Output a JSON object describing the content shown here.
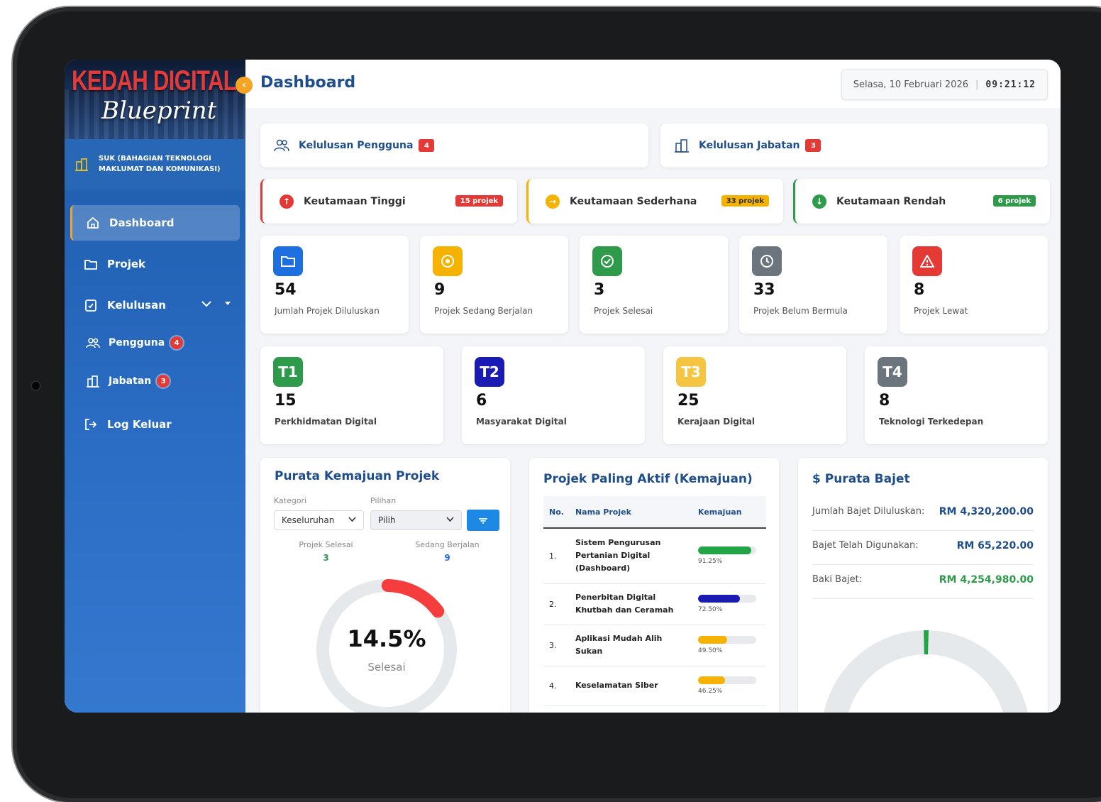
{
  "brand": {
    "title": "KEDAH DIGITAL",
    "subtitle": "Blueprint"
  },
  "org": {
    "name": "SUK (BAHAGIAN TEKNOLOGI MAKLUMAT DAN KOMUNIKASI)"
  },
  "sidebar": {
    "items": [
      {
        "label": "Dashboard",
        "icon": "home-icon"
      },
      {
        "label": "Projek",
        "icon": "folder-icon"
      },
      {
        "label": "Kelulusan",
        "icon": "clipboard-check-icon"
      },
      {
        "label": "Log Keluar",
        "icon": "logout-icon"
      }
    ],
    "subitems": [
      {
        "label": "Pengguna",
        "badge": "4"
      },
      {
        "label": "Jabatan",
        "badge": "3"
      }
    ]
  },
  "header": {
    "title": "Dashboard",
    "date": "Selasa, 10 Februari 2026",
    "separator": "|",
    "time": "09:21:12"
  },
  "approvals": [
    {
      "label": "Kelulusan Pengguna",
      "badge": "4"
    },
    {
      "label": "Kelulusan Jabatan",
      "badge": "3"
    }
  ],
  "priorities": [
    {
      "label": "Keutamaan Tinggi",
      "pill": "15 projek",
      "color": "#e53935"
    },
    {
      "label": "Keutamaan Sederhana",
      "pill": "33 projek",
      "color": "#f5b300"
    },
    {
      "label": "Keutamaan Rendah",
      "pill": "6 projek",
      "color": "#2e9b4b"
    }
  ],
  "stats": [
    {
      "value": "54",
      "label": "Jumlah Projek Diluluskan",
      "color": "#1e6fe0"
    },
    {
      "value": "9",
      "label": "Projek Sedang Berjalan",
      "color": "#f5b300"
    },
    {
      "value": "3",
      "label": "Projek Selesai",
      "color": "#2e9b4b"
    },
    {
      "value": "33",
      "label": "Projek Belum Bermula",
      "color": "#6c757d"
    },
    {
      "value": "8",
      "label": "Projek Lewat",
      "color": "#e53935"
    }
  ],
  "thrusts": [
    {
      "code": "T1",
      "value": "15",
      "label": "Perkhidmatan Digital",
      "color": "#2e9b4b"
    },
    {
      "code": "T2",
      "value": "6",
      "label": "Masyarakat Digital",
      "color": "#1a1bb5"
    },
    {
      "code": "T3",
      "value": "25",
      "label": "Kerajaan Digital",
      "color": "#f5c542"
    },
    {
      "code": "T4",
      "value": "8",
      "label": "Teknologi Terkedepan",
      "color": "#6c757d"
    }
  ],
  "progress_panel": {
    "title": "Purata Kemajuan Projek",
    "kategori_label": "Kategori",
    "kategori_value": "Keseluruhan",
    "pilihan_label": "Pilihan",
    "pilihan_value": "Pilih",
    "selesai_label": "Projek Selesai",
    "selesai_value": "3",
    "berjalan_label": "Sedang Berjalan",
    "berjalan_value": "9",
    "gauge_value": "14.5%",
    "gauge_percent": 14.5,
    "gauge_label": "Selesai"
  },
  "active_panel": {
    "title": "Projek Paling Aktif (Kemajuan)",
    "columns": [
      "No.",
      "Nama Projek",
      "Kemajuan"
    ],
    "rows": [
      {
        "no": "1.",
        "name": "Sistem Pengurusan Pertanian Digital (Dashboard)",
        "percent": 91.25,
        "label": "91.25%",
        "color": "#22a447"
      },
      {
        "no": "2.",
        "name": "Penerbitan Digital Khutbah dan Ceramah",
        "percent": 72.5,
        "label": "72.50%",
        "color": "#1a1bb5"
      },
      {
        "no": "3.",
        "name": "Aplikasi Mudah Alih Sukan",
        "percent": 49.5,
        "label": "49.50%",
        "color": "#f5b300"
      },
      {
        "no": "4.",
        "name": "Keselamatan Siber",
        "percent": 46.25,
        "label": "46.25%",
        "color": "#f5b300"
      }
    ]
  },
  "budget_panel": {
    "title": "$ Purata Bajet",
    "rows": [
      {
        "label": "Jumlah Bajet Diluluskan:",
        "value": "RM 4,320,200.00",
        "color": "#1f4e8c"
      },
      {
        "label": "Bajet Telah Digunakan:",
        "value": "RM 65,220.00",
        "color": "#1f4e8c"
      },
      {
        "label": "Baki Bajet:",
        "value": "RM 4,254,980.00",
        "color": "#2e9b4b"
      }
    ],
    "used_fraction": 0.015
  }
}
